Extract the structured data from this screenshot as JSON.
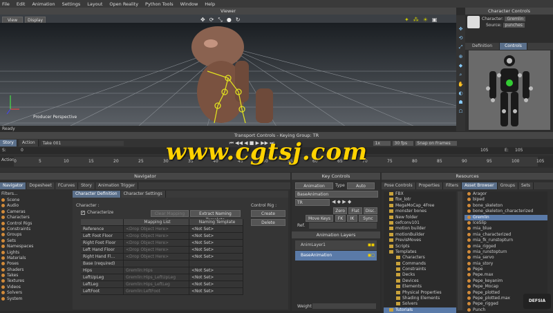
{
  "menu": [
    "File",
    "Edit",
    "Animation",
    "Settings",
    "Layout",
    "Open Reality",
    "Python Tools",
    "Window",
    "Help"
  ],
  "viewer": {
    "title": "Viewer",
    "view_btn": "View",
    "display_btn": "Display",
    "perspective": "Producer Perspective"
  },
  "status": "Ready",
  "char_controls": {
    "title": "Character Controls",
    "character_label": "Character:",
    "character_value": "Gremlin",
    "source_label": "Source:",
    "source_value": "punches",
    "tab_definition": "Definition",
    "tab_controls": "Controls"
  },
  "transport": {
    "title": "Transport Controls - Keying Group: TR",
    "story": "Story",
    "action": "Action",
    "take": "Take 001",
    "s_label": "S:",
    "s_value": "0",
    "e_label": "E:",
    "e_value": "105",
    "end_value": "105",
    "speed": "1x",
    "fps": "30 fps",
    "snap": "Snap on Frames",
    "action_label": "Action",
    "ticks": [
      "0",
      "5",
      "10",
      "15",
      "20",
      "25",
      "30",
      "35",
      "40",
      "45",
      "50",
      "55",
      "60",
      "65",
      "70",
      "75",
      "80",
      "85",
      "90",
      "95",
      "100",
      "105"
    ]
  },
  "watermark": "www.cgtsj.com",
  "navigator": {
    "title": "Navigator",
    "tabs": [
      "Navigator",
      "Dopesheet",
      "FCurves",
      "Story",
      "Animation Trigger"
    ],
    "filters": "Filters...",
    "tree": [
      "Scene",
      "Audio",
      "Cameras",
      "Characters",
      "Control Rigs",
      "Constraints",
      "Groups",
      "Sets",
      "Namespaces",
      "Lights",
      "Materials",
      "Poses",
      "Shaders",
      "Takes",
      "Textures",
      "Videos",
      "Solvers",
      "System"
    ]
  },
  "chardef": {
    "tab1": "Character Definition",
    "tab2": "Character Settings",
    "character_label": "Character :",
    "characterize": "Characterize",
    "clear_mapping": "Clear Mapping L...",
    "extract_naming": "Extract Naming Template",
    "control_rig_label": "Control Rig :",
    "create": "Create",
    "delete": "Delete",
    "col_mapping": "Mapping List",
    "col_naming": "Naming Template",
    "rows": [
      {
        "name": "Reference",
        "map": "<Drop Object Here>",
        "tmpl": "<Not Set>"
      },
      {
        "name": "Left Foot Floor",
        "map": "<Drop Object Here>",
        "tmpl": "<Not Set>"
      },
      {
        "name": "Right Foot Floor",
        "map": "<Drop Object Here>",
        "tmpl": "<Not Set>"
      },
      {
        "name": "Left Hand Floor",
        "map": "<Drop Object Here>",
        "tmpl": "<Not Set>"
      },
      {
        "name": "Right Hand Fl...",
        "map": "<Drop Object Here>",
        "tmpl": "<Not Set>"
      },
      {
        "name": "Base (required)",
        "map": "",
        "tmpl": ""
      },
      {
        "name": "Hips",
        "map": "Gremlin:Hips",
        "tmpl": "<Not Set>"
      },
      {
        "name": "LeftUpLeg",
        "map": "Gremlin:Hips_LeftUpLeg",
        "tmpl": "<Not Set>"
      },
      {
        "name": "LeftLeg",
        "map": "Gremlin:Hips_LeftLeg",
        "tmpl": "<Not Set>"
      },
      {
        "name": "LeftFoot",
        "map": "Gremlin:LeftFoot",
        "tmpl": "<Not Set>"
      }
    ]
  },
  "key_controls": {
    "title": "Key Controls",
    "animation": "Animation",
    "type_label": "Type",
    "type_value": "Auto",
    "base_anim": "BaseAnimation",
    "tr": "TR",
    "zero": "Zero",
    "flat": "Flat",
    "disc": "Disc.",
    "move_keys": "Move Keys",
    "fk": "FK",
    "ik": "IK",
    "sync": "Sync",
    "ref": "Ref.",
    "layers_title": "Animation Layers",
    "layer1": "AnimLayer1",
    "layer2": "BaseAnimation",
    "weight": "Weight"
  },
  "resources": {
    "title": "Resources",
    "tabs": [
      "Pose Controls",
      "Properties",
      "Filters",
      "Asset Browser",
      "Groups",
      "Sets"
    ],
    "folders": [
      "FBX",
      "fbx_lotr",
      "MegaMoCap_4Free",
      "monster bones",
      "New folder",
      "oxfconv101",
      "motion builder",
      "motionBuilder",
      "PrevisMoves",
      "Scripts",
      "Templates",
      "Characters",
      "Commands",
      "Constraints",
      "Decks",
      "Devices",
      "Elements",
      "Physical Properties",
      "Shading Elements",
      "Solvers",
      "Tutorials"
    ],
    "assets": [
      "Aragor",
      "biped",
      "bone_skeleton",
      "bone_skeleton_characterized",
      "Gremlin",
      "IceSlip",
      "mia_blue",
      "mia_characterized",
      "mia_fk_runstopturn",
      "mia_rigged",
      "mia_runstopturn",
      "mia_servo",
      "mia_story",
      "Pepe",
      "Pepe.max",
      "Pepe_keyanim",
      "Pepe_Mocap",
      "Pepe_plotted",
      "Pepe_plotted.max",
      "Pepe_rigged",
      "Punch"
    ],
    "selected_asset": "Gremlin",
    "logo": "DEFSIA"
  }
}
